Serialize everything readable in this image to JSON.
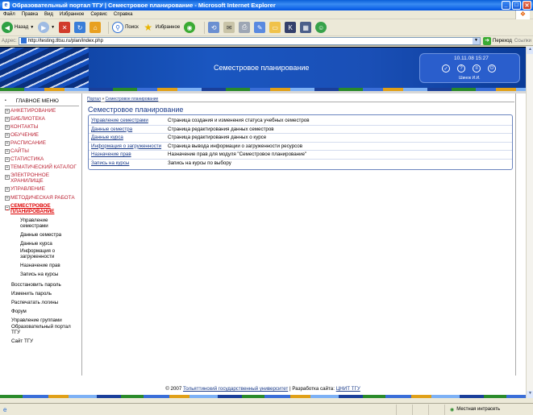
{
  "window": {
    "title": "Образовательный портал ТГУ | Семестровое планирование - Microsoft Internet Explorer",
    "app_icon": "e"
  },
  "menubar": [
    "Файл",
    "Правка",
    "Вид",
    "Избранное",
    "Сервис",
    "Справка"
  ],
  "toolbar": {
    "back": "Назад",
    "search": "Поиск",
    "favorites": "Избранное"
  },
  "addressbar": {
    "label": "Адрес:",
    "url": "http://testing.tltsu.ru/plan/index.php",
    "go": "Переход",
    "links": "Ссылки"
  },
  "header": {
    "site_title": "Семестровое планирование",
    "datetime": "10.11.08 15:27",
    "user": "Шинок И.И."
  },
  "menu": {
    "head": "ГЛАВНОЕ МЕНЮ",
    "items": [
      "АНКЕТИРОВАНИЕ",
      "БИБЛИОТЕКА",
      "КОНТАКТЫ",
      "ОБУЧЕНИЕ",
      "РАСПИСАНИЕ",
      "САЙТЫ",
      "СТАТИСТИКА",
      "ТЕМАТИЧЕСКИЙ КАТАЛОГ",
      "ЭЛЕКТРОННОЕ ХРАНИЛИЩЕ",
      "УПРАВЛЕНИЕ",
      "МЕТОДИЧЕСКАЯ РАБОТА"
    ],
    "active": "СЕМЕСТРОВОЕ ПЛАНИРОВАНИЕ",
    "sub": [
      "Управление семестрами",
      "Данные семестра",
      "Данные курса",
      "Информация о загруженности",
      "Назначение прав",
      "Запись на курсы"
    ],
    "plain": [
      "Восстановить пароль",
      "Изменить пароль",
      "Распечатать логины",
      "Форум",
      "Управление группами",
      "Образовательный портал ТГУ",
      "Сайт ТГУ"
    ]
  },
  "breadcrumb": {
    "home": "Портал",
    "sep": "»",
    "current": "Семестровое планирование"
  },
  "content": {
    "title": "Семестровое планирование",
    "rows": [
      {
        "link": "Управление семестрами",
        "desc": "Страница создания и изменения статуса учебных семестров"
      },
      {
        "link": "Данные семестра",
        "desc": "Страница редактирования данных семестров"
      },
      {
        "link": "Данные курса",
        "desc": "Страница редактирования данных о курсе"
      },
      {
        "link": "Информация о загруженности",
        "desc": "Страница вывода информации о загруженности ресурсов"
      },
      {
        "link": "Назначение прав",
        "desc": "Назначение прав для модуля \"Семестровое планирование\""
      },
      {
        "link": "Запись на курсы",
        "desc": "Запись на курсы по выбору"
      }
    ]
  },
  "footer": {
    "copy": "© 2007",
    "university": "Тольяттинский государственный университет",
    "sep": "| Разработка сайта:",
    "dev": "ЦНИТ ТГУ"
  },
  "statusbar": {
    "zone": "Местная интрасеть"
  },
  "colors": {
    "title_bar": "#0054E3",
    "header_bg": "#1a56c0",
    "link": "#1a3b8a",
    "menu_red": "#b23"
  }
}
